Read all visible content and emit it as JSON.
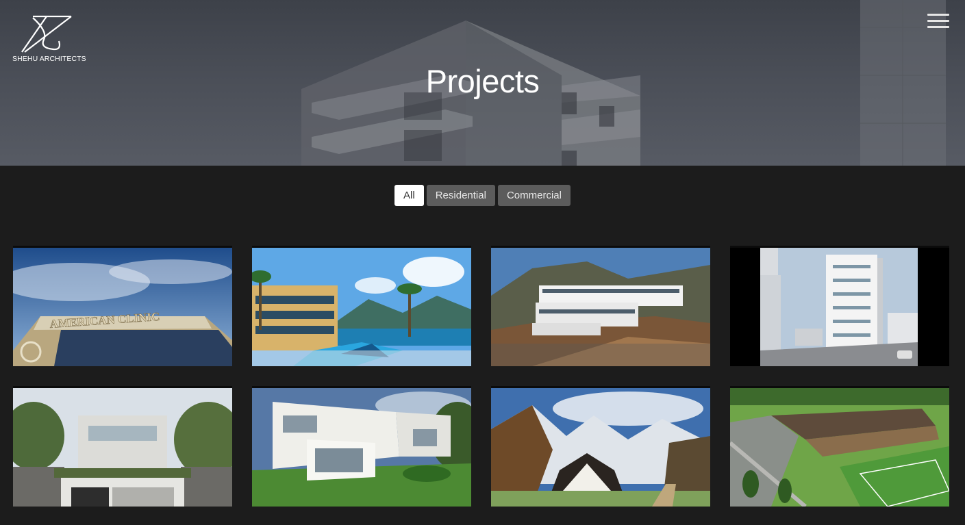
{
  "header": {
    "logo_text": "SHEHU ARCHITECTS",
    "menu_icon": "hamburger-icon",
    "title": "Projects"
  },
  "filters": [
    {
      "label": "All",
      "active": true
    },
    {
      "label": "Residential",
      "active": false
    },
    {
      "label": "Commercial",
      "active": false
    }
  ],
  "projects": [
    {
      "id": 1,
      "sign_text": "AMERICAN CLINIC"
    },
    {
      "id": 2
    },
    {
      "id": 3
    },
    {
      "id": 4
    },
    {
      "id": 5
    },
    {
      "id": 6
    },
    {
      "id": 7
    },
    {
      "id": 8
    }
  ],
  "colors": {
    "page_bg": "#1c1c1c",
    "filter_active_bg": "#ffffff",
    "filter_bg": "#5c5c5c"
  }
}
